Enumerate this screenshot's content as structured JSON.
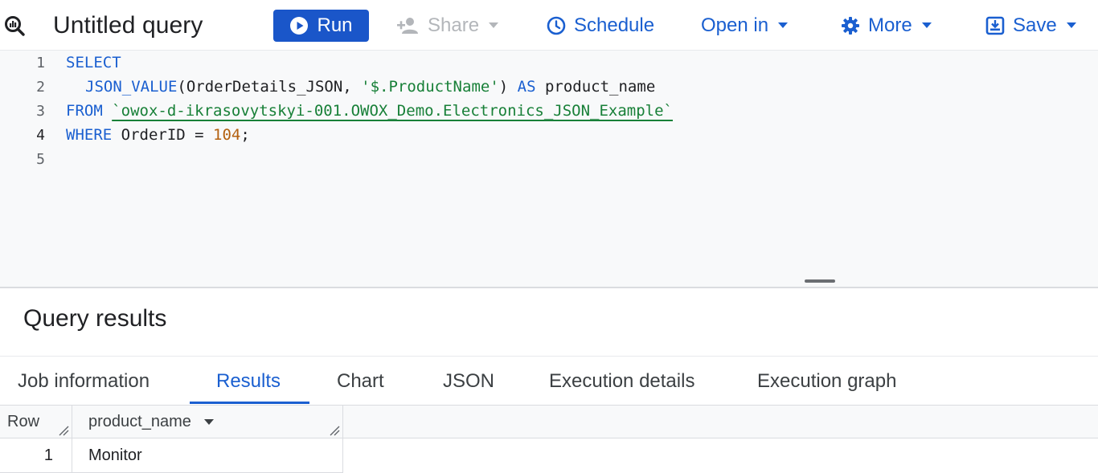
{
  "toolbar": {
    "title": "Untitled query",
    "run_label": "Run",
    "share_label": "Share",
    "schedule_label": "Schedule",
    "open_in_label": "Open in",
    "more_label": "More",
    "save_label": "Save"
  },
  "editor": {
    "line_numbers": [
      "1",
      "2",
      "3",
      "4",
      "5"
    ],
    "lines": {
      "l1_kw": "SELECT",
      "l2_fn": "JSON_VALUE",
      "l2_args": "(OrderDetails_JSON, ",
      "l2_str": "'$.ProductName'",
      "l2_close": ") ",
      "l2_as": "AS",
      "l2_alias": " product_name",
      "l3_kw": "FROM ",
      "l3_table": "`owox-d-ikrasovytskyi-001.OWOX_Demo.Electronics_JSON_Example`",
      "l4_kw": "WHERE",
      "l4_cond": " OrderID = ",
      "l4_num": "104",
      "l4_end": ";"
    }
  },
  "results": {
    "title": "Query results",
    "tabs": [
      "Job information",
      "Results",
      "Chart",
      "JSON",
      "Execution details",
      "Execution graph"
    ],
    "active_tab": "Results",
    "columns": [
      "Row",
      "product_name"
    ],
    "rows": [
      {
        "row": "1",
        "product_name": "Monitor"
      }
    ]
  },
  "colors": {
    "accent": "#1a5fd0",
    "run_button": "#1a56c9",
    "keyword": "#1a5fd0",
    "string": "#188038",
    "number": "#b3600f"
  },
  "icons": {
    "query": "query-icon",
    "run": "play-circle-icon",
    "share": "person-add-icon",
    "schedule": "clock-icon",
    "more": "gear-icon",
    "save": "save-icon"
  }
}
